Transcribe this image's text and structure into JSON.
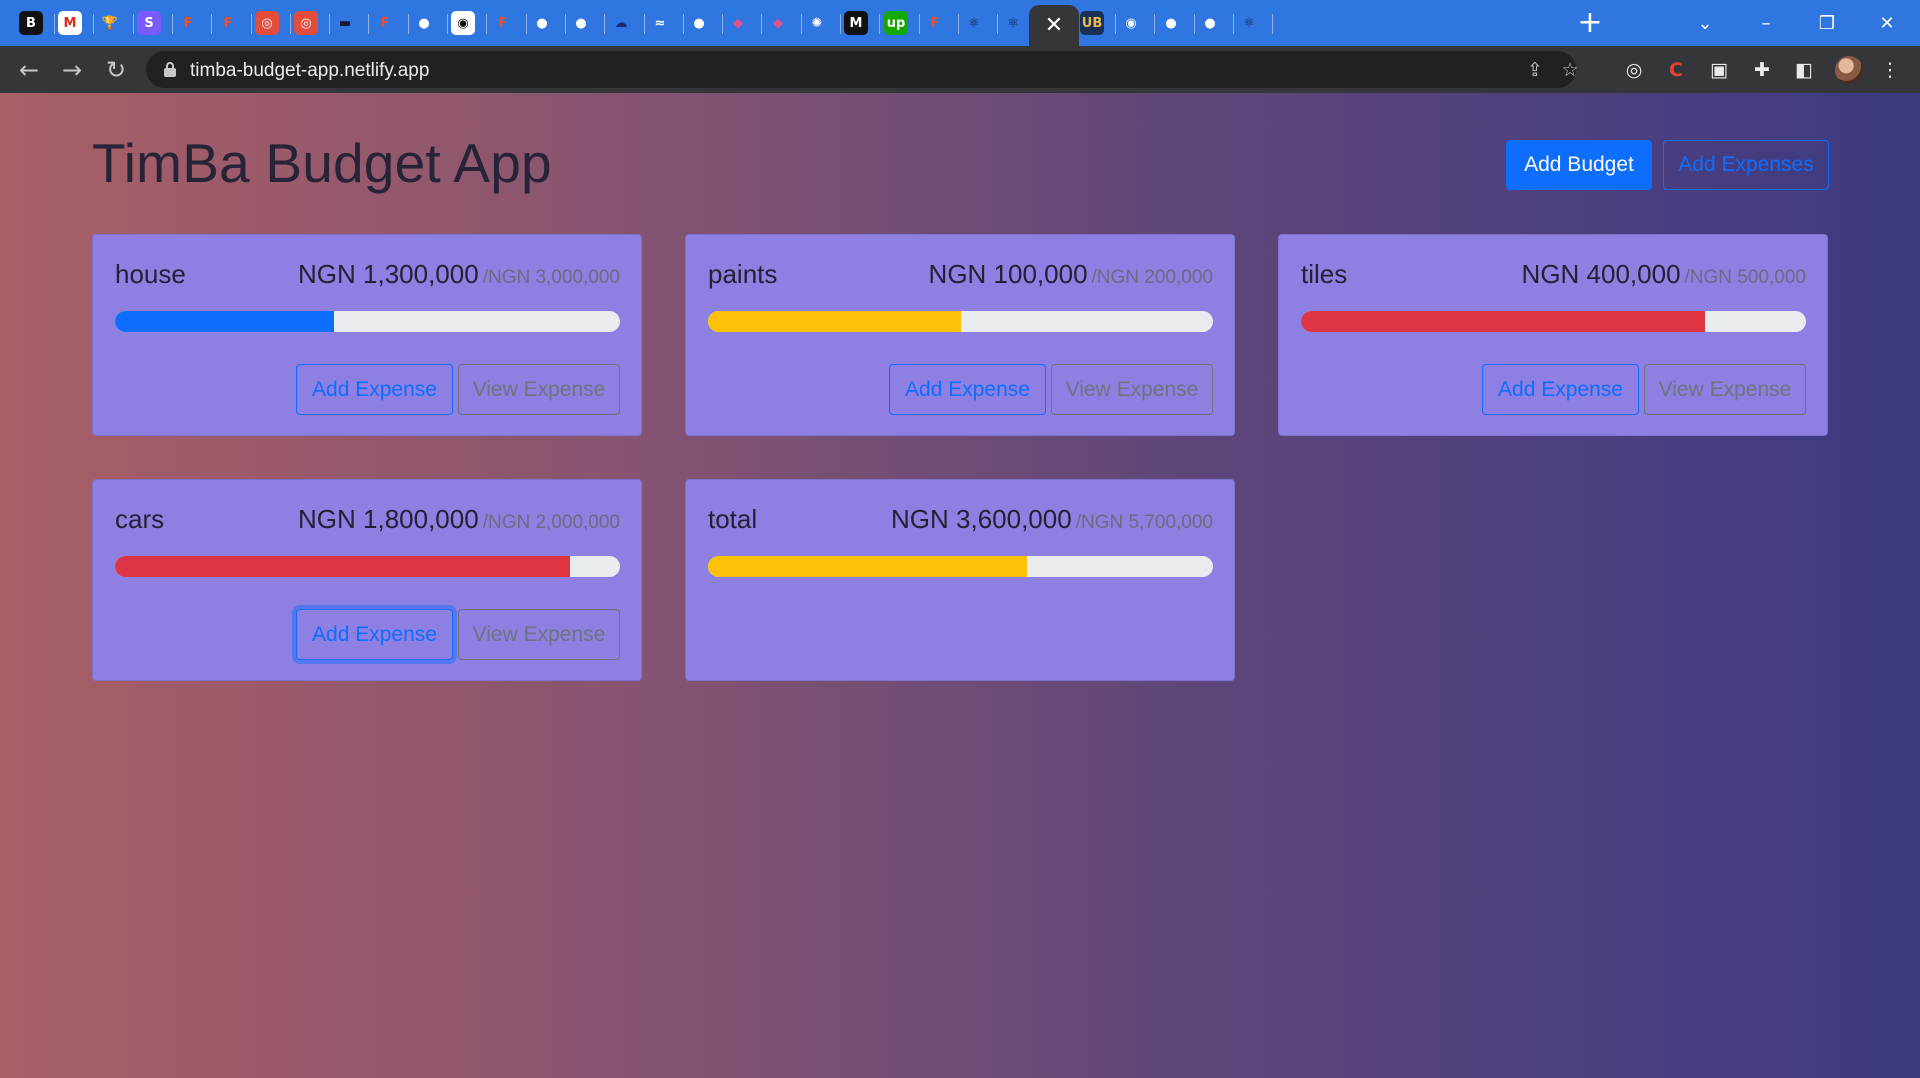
{
  "browser": {
    "tabs": [
      {
        "icon": "bereal-icon",
        "glyph": "B",
        "bg": "#111111",
        "fg": "#ffffff"
      },
      {
        "icon": "gmail-icon",
        "glyph": "M",
        "bg": "#ffffff",
        "fg": "#d93025"
      },
      {
        "icon": "trophy-icon",
        "glyph": "🏆",
        "bg": "transparent",
        "fg": "#0b1f3a"
      },
      {
        "icon": "stripe-icon",
        "glyph": "S",
        "bg": "#7a5af8",
        "fg": "#ffffff"
      },
      {
        "icon": "figma-icon",
        "glyph": "F",
        "bg": "transparent",
        "fg": "#f24e1e"
      },
      {
        "icon": "figma-icon",
        "glyph": "F",
        "bg": "transparent",
        "fg": "#f24e1e"
      },
      {
        "icon": "coding-tab-icon",
        "glyph": "◎",
        "bg": "#e44c3c",
        "fg": "#ffffff"
      },
      {
        "icon": "coding-tab-icon",
        "glyph": "◎",
        "bg": "#e44c3c",
        "fg": "#ffffff"
      },
      {
        "icon": "document-icon",
        "glyph": "▬",
        "bg": "transparent",
        "fg": "#1a1a2e"
      },
      {
        "icon": "figma-icon",
        "glyph": "F",
        "bg": "transparent",
        "fg": "#f24e1e"
      },
      {
        "icon": "github-icon",
        "glyph": "●",
        "bg": "transparent",
        "fg": "#ffffff"
      },
      {
        "icon": "circle-logo-icon",
        "glyph": "◉",
        "bg": "#ffffff",
        "fg": "#111111"
      },
      {
        "icon": "figma-icon",
        "glyph": "F",
        "bg": "transparent",
        "fg": "#f24e1e"
      },
      {
        "icon": "github-icon",
        "glyph": "●",
        "bg": "transparent",
        "fg": "#ffffff"
      },
      {
        "icon": "github-icon",
        "glyph": "●",
        "bg": "transparent",
        "fg": "#ffffff"
      },
      {
        "icon": "cloud-icon",
        "glyph": "☁",
        "bg": "transparent",
        "fg": "#1c2a6b"
      },
      {
        "icon": "tailwind-icon",
        "glyph": "≈",
        "bg": "transparent",
        "fg": "#ffffff"
      },
      {
        "icon": "github-icon",
        "glyph": "●",
        "bg": "transparent",
        "fg": "#ffffff"
      },
      {
        "icon": "stack-icon",
        "glyph": "◆",
        "bg": "transparent",
        "fg": "#e0508c"
      },
      {
        "icon": "stack-icon",
        "glyph": "◆",
        "bg": "transparent",
        "fg": "#e0508c"
      },
      {
        "icon": "openai-icon",
        "glyph": "✺",
        "bg": "transparent",
        "fg": "#ffffff"
      },
      {
        "icon": "medium-icon",
        "glyph": "M",
        "bg": "#111111",
        "fg": "#ffffff"
      },
      {
        "icon": "upwork-icon",
        "glyph": "up",
        "bg": "#14a800",
        "fg": "#ffffff"
      },
      {
        "icon": "figma-icon",
        "glyph": "F",
        "bg": "transparent",
        "fg": "#f24e1e"
      },
      {
        "icon": "react-icon",
        "glyph": "⚛",
        "bg": "transparent",
        "fg": "#0b1f3a"
      },
      {
        "icon": "react-icon",
        "glyph": "⚛",
        "bg": "transparent",
        "fg": "#0b1f3a"
      },
      {
        "icon": "close-icon",
        "glyph": "✕",
        "bg": "transparent",
        "fg": "#ffffff",
        "active": true
      },
      {
        "icon": "ub-icon",
        "glyph": "UB",
        "bg": "#1a2f55",
        "fg": "#e9b949"
      },
      {
        "icon": "chrome-icon",
        "glyph": "◉",
        "bg": "transparent",
        "fg": "#ffffff"
      },
      {
        "icon": "github-icon",
        "glyph": "●",
        "bg": "transparent",
        "fg": "#ffffff"
      },
      {
        "icon": "github-icon",
        "glyph": "●",
        "bg": "transparent",
        "fg": "#ffffff"
      },
      {
        "icon": "react-icon",
        "glyph": "⚛",
        "bg": "transparent",
        "fg": "#0b1f3a"
      }
    ],
    "url": "timba-budget-app.netlify.app"
  },
  "app": {
    "title": "TimBa Budget App",
    "add_budget_label": "Add Budget",
    "add_expenses_label": "Add Expenses",
    "add_expense_label": "Add Expense",
    "view_expense_label": "View Expense"
  },
  "budgets": [
    {
      "name": "house",
      "amount": "NGN 1,300,000",
      "max": "/NGN 3,000,000",
      "ratio": 0.4333,
      "color": "#0d6efd"
    },
    {
      "name": "paints",
      "amount": "NGN 100,000",
      "max": "/NGN 200,000",
      "ratio": 0.5,
      "color": "#ffc107"
    },
    {
      "name": "tiles",
      "amount": "NGN 400,000",
      "max": "/NGN 500,000",
      "ratio": 0.8,
      "color": "#dc3545"
    },
    {
      "name": "cars",
      "amount": "NGN 1,800,000",
      "max": "/NGN 2,000,000",
      "ratio": 0.9,
      "color": "#dc3545"
    },
    {
      "name": "total",
      "amount": "NGN 3,600,000",
      "max": "/NGN 5,700,000",
      "ratio": 0.6316,
      "color": "#ffc107"
    }
  ]
}
